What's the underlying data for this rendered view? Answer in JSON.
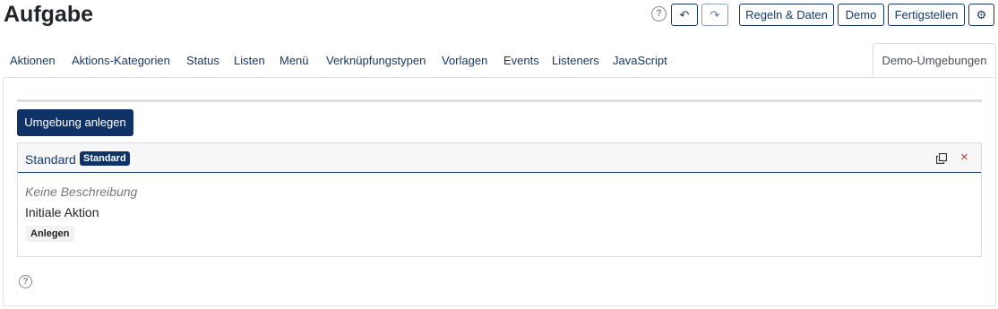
{
  "header": {
    "title": "Aufgabe",
    "help_glyph": "?",
    "undo_glyph": "↶",
    "redo_glyph": "↷",
    "rules_label": "Regeln & Daten",
    "demo_label": "Demo",
    "finish_label": "Fertigstellen",
    "gear_glyph": "⚙"
  },
  "tabs": [
    {
      "label": "Aktionen"
    },
    {
      "label": "Aktions-Kategorien"
    },
    {
      "label": "Status"
    },
    {
      "label": "Listen"
    },
    {
      "label": "Menü"
    },
    {
      "label": "Verknüpfungstypen"
    },
    {
      "label": "Vorlagen"
    },
    {
      "label": "Events"
    },
    {
      "label": "Listeners"
    },
    {
      "label": "JavaScript"
    },
    {
      "label": "Demo-Umgebungen",
      "active": true
    }
  ],
  "panel": {
    "add_button_label": "Umgebung anlegen",
    "environment": {
      "name": "Standard",
      "badge": "Standard",
      "description": "Keine Beschreibung",
      "initial_action_label": "Initiale Aktion",
      "initial_action_value": "Anlegen",
      "close_glyph": "×"
    },
    "help_glyph": "?"
  },
  "colors": {
    "primary": "#0f3366",
    "link": "#17386b",
    "danger": "#c0392b",
    "muted": "#777777"
  },
  "icons": [
    "help-icon",
    "undo-icon",
    "redo-icon",
    "gear-icon",
    "copy-icon",
    "close-icon"
  ]
}
